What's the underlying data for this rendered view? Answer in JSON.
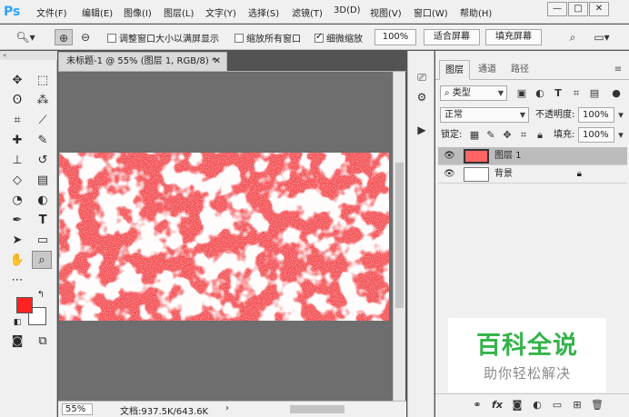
{
  "app": {
    "logo": "Ps"
  },
  "menu": [
    "文件(F)",
    "编辑(E)",
    "图像(I)",
    "图层(L)",
    "文字(Y)",
    "选择(S)",
    "滤镜(T)",
    "3D(D)",
    "视图(V)",
    "窗口(W)",
    "帮助(H)"
  ],
  "window_controls": {
    "minimize": "—",
    "restore": "□",
    "close": "✕"
  },
  "options": {
    "resize_windows": "调整窗口大小以满屏显示",
    "zoom_all": "缩放所有窗口",
    "scrubby_zoom": "细微缩放",
    "zoom_100": "100%",
    "fit_screen": "适合屏幕",
    "fill_screen": "填充屏幕",
    "resize_checked": false,
    "zoom_all_checked": false,
    "scrubby_checked": true
  },
  "document": {
    "tab_title": "未标题-1 @ 55% (图层 1, RGB/8) *",
    "close": "✕",
    "zoom": "55%",
    "info": "文档:937.5K/643.6K",
    "info_arrow": "›"
  },
  "colors": {
    "foreground": "#ff2222",
    "background": "#ffffff",
    "accent_blue": "#2fa3f7"
  },
  "layers_panel": {
    "tabs": [
      "图层",
      "通道",
      "路径"
    ],
    "active_tab": 0,
    "filter_label": "类型",
    "blend_mode": "正常",
    "opacity_label": "不透明度:",
    "opacity_value": "100%",
    "lock_label": "锁定:",
    "fill_label": "填充:",
    "fill_value": "100%",
    "layers": [
      {
        "name": "图层 1",
        "selected": true,
        "visible": true,
        "locked": false
      },
      {
        "name": "背景",
        "selected": false,
        "visible": true,
        "locked": true
      }
    ]
  },
  "watermark": {
    "title": "百科全说",
    "subtitle": "助你轻松解决"
  }
}
